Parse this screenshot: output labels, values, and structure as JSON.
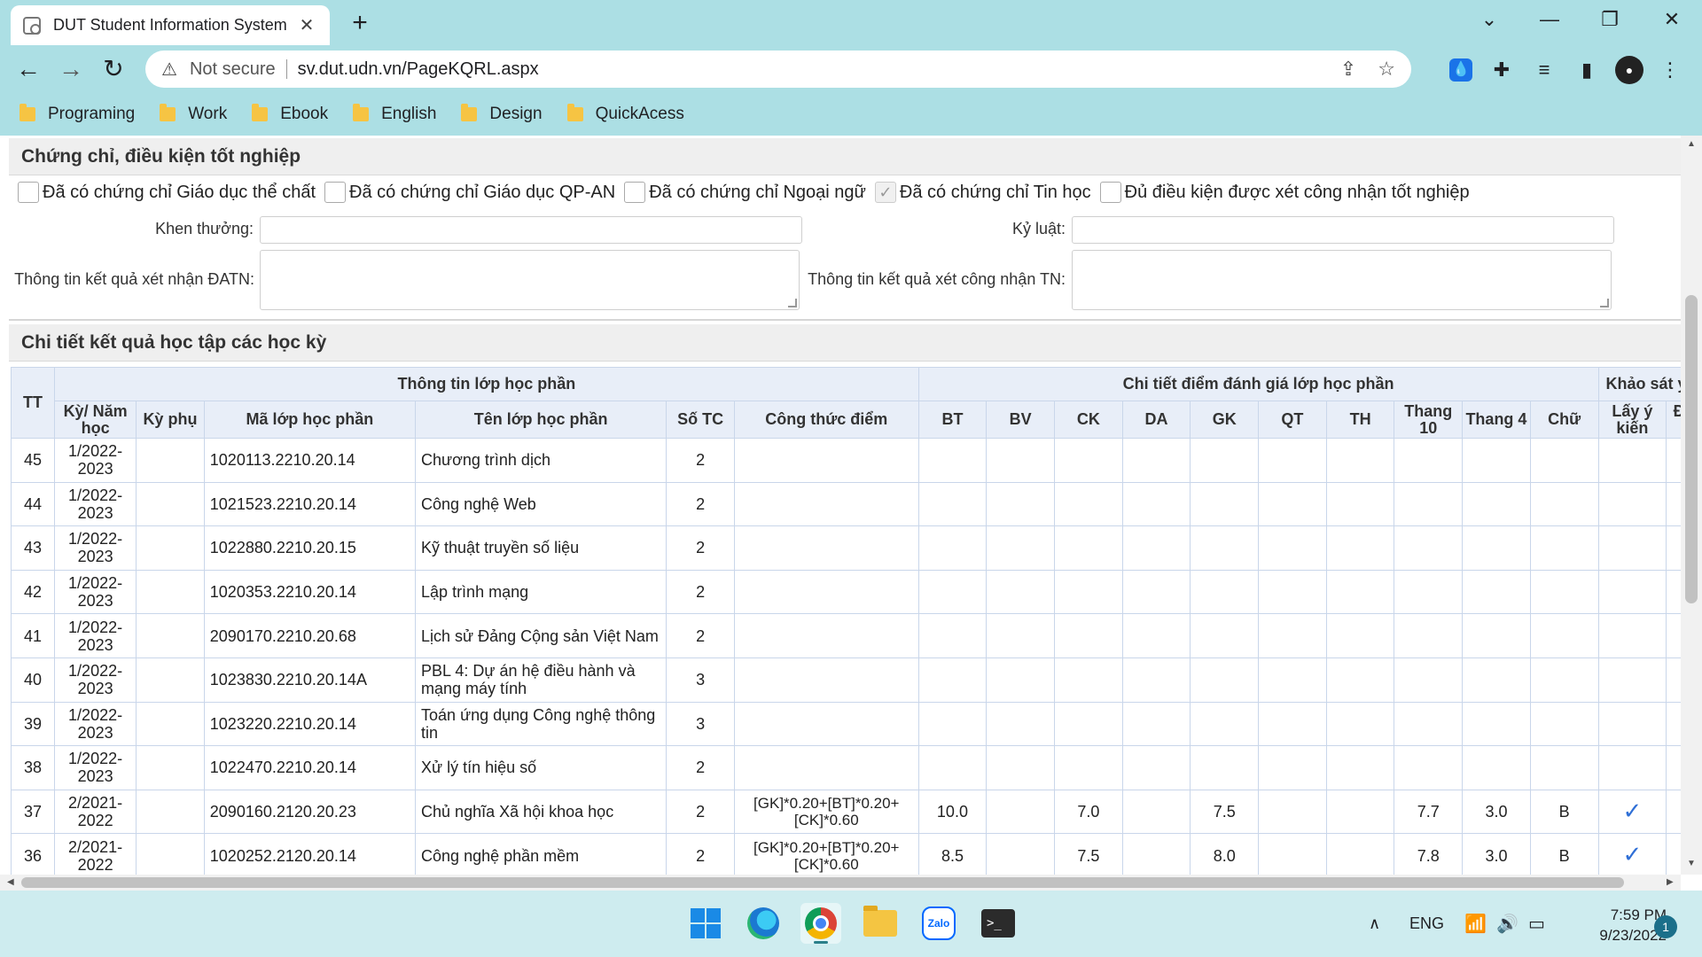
{
  "browser": {
    "tab_title": "DUT Student Information System",
    "tab_close": "✕",
    "new_tab": "+",
    "security_label": "Not secure",
    "url": "sv.dut.udn.vn/PageKQRL.aspx",
    "bookmarks": [
      "Programing",
      "Work",
      "Ebook",
      "English",
      "Design",
      "QuickAcess"
    ]
  },
  "certificates": {
    "title": "Chứng chỉ, điều kiện tốt nghiệp",
    "items": [
      {
        "label": "Đã có chứng chỉ Giáo dục thể chất",
        "checked": false
      },
      {
        "label": "Đã có chứng chỉ Giáo dục QP-AN",
        "checked": false
      },
      {
        "label": "Đã có chứng chỉ Ngoại ngữ",
        "checked": false
      },
      {
        "label": "Đã có chứng chỉ Tin học",
        "checked": true
      },
      {
        "label": "Đủ điều kiện được xét công nhận tốt nghiệp",
        "checked": false
      }
    ],
    "khen_thuong_label": "Khen thưởng:",
    "ky_luat_label": "Kỷ luật:",
    "datn_label": "Thông tin kết quả xét nhận ĐATN:",
    "tn_label": "Thông tin kết quả xét công nhận TN:"
  },
  "results": {
    "title": "Chi tiết kết quả học tập các học kỳ",
    "group_headers": {
      "tt": "TT",
      "class_info": "Thông tin lớp học phần",
      "score_detail": "Chi tiết điểm đánh giá lớp học phần",
      "survey": "Khảo sát ý kiến"
    },
    "columns": {
      "ky": "Kỳ/ Năm học",
      "ky_phu": "Kỳ phụ",
      "ma_lop": "Mã lớp học phần",
      "ten_lop": "Tên lớp học phần",
      "so_tc": "Số TC",
      "cong_thuc": "Công thức điểm",
      "bt": "BT",
      "bv": "BV",
      "ck": "CK",
      "da": "DA",
      "gk": "GK",
      "qt": "QT",
      "th": "TH",
      "thang10": "Thang 10",
      "thang4": "Thang 4",
      "chu": "Chữ",
      "lay_y_kien": "Lấy ý kiến",
      "da_gop_y": "Đã góp ý"
    },
    "rows": [
      {
        "tt": "45",
        "ky": "1/2022-2023",
        "ky_phu": "",
        "ma": "1020113.2210.20.14",
        "ten": "Chương trình dịch",
        "tc": "2",
        "ct": "",
        "bt": "",
        "bv": "",
        "ck": "",
        "da": "",
        "gk": "",
        "qt": "",
        "th": "",
        "t10": "",
        "t4": "",
        "chu": "",
        "lay": "",
        "gop": ""
      },
      {
        "tt": "44",
        "ky": "1/2022-2023",
        "ky_phu": "",
        "ma": "1021523.2210.20.14",
        "ten": "Công nghệ Web",
        "tc": "2",
        "ct": "",
        "bt": "",
        "bv": "",
        "ck": "",
        "da": "",
        "gk": "",
        "qt": "",
        "th": "",
        "t10": "",
        "t4": "",
        "chu": "",
        "lay": "",
        "gop": ""
      },
      {
        "tt": "43",
        "ky": "1/2022-2023",
        "ky_phu": "",
        "ma": "1022880.2210.20.15",
        "ten": "Kỹ thuật truyền số liệu",
        "tc": "2",
        "ct": "",
        "bt": "",
        "bv": "",
        "ck": "",
        "da": "",
        "gk": "",
        "qt": "",
        "th": "",
        "t10": "",
        "t4": "",
        "chu": "",
        "lay": "",
        "gop": ""
      },
      {
        "tt": "42",
        "ky": "1/2022-2023",
        "ky_phu": "",
        "ma": "1020353.2210.20.14",
        "ten": "Lập trình mạng",
        "tc": "2",
        "ct": "",
        "bt": "",
        "bv": "",
        "ck": "",
        "da": "",
        "gk": "",
        "qt": "",
        "th": "",
        "t10": "",
        "t4": "",
        "chu": "",
        "lay": "",
        "gop": ""
      },
      {
        "tt": "41",
        "ky": "1/2022-2023",
        "ky_phu": "",
        "ma": "2090170.2210.20.68",
        "ten": "Lịch sử Đảng Cộng sản Việt Nam",
        "tc": "2",
        "ct": "",
        "bt": "",
        "bv": "",
        "ck": "",
        "da": "",
        "gk": "",
        "qt": "",
        "th": "",
        "t10": "",
        "t4": "",
        "chu": "",
        "lay": "",
        "gop": ""
      },
      {
        "tt": "40",
        "ky": "1/2022-2023",
        "ky_phu": "",
        "ma": "1023830.2210.20.14A",
        "ten": "PBL 4: Dự án hệ điều hành và mạng máy tính",
        "tc": "3",
        "ct": "",
        "bt": "",
        "bv": "",
        "ck": "",
        "da": "",
        "gk": "",
        "qt": "",
        "th": "",
        "t10": "",
        "t4": "",
        "chu": "",
        "lay": "",
        "gop": ""
      },
      {
        "tt": "39",
        "ky": "1/2022-2023",
        "ky_phu": "",
        "ma": "1023220.2210.20.14",
        "ten": "Toán ứng dụng Công nghệ thông tin",
        "tc": "3",
        "ct": "",
        "bt": "",
        "bv": "",
        "ck": "",
        "da": "",
        "gk": "",
        "qt": "",
        "th": "",
        "t10": "",
        "t4": "",
        "chu": "",
        "lay": "",
        "gop": ""
      },
      {
        "tt": "38",
        "ky": "1/2022-2023",
        "ky_phu": "",
        "ma": "1022470.2210.20.14",
        "ten": "Xử lý tín hiệu số",
        "tc": "2",
        "ct": "",
        "bt": "",
        "bv": "",
        "ck": "",
        "da": "",
        "gk": "",
        "qt": "",
        "th": "",
        "t10": "",
        "t4": "",
        "chu": "",
        "lay": "",
        "gop": ""
      },
      {
        "tt": "37",
        "ky": "2/2021-2022",
        "ky_phu": "",
        "ma": "2090160.2120.20.23",
        "ten": "Chủ nghĩa Xã hội khoa học",
        "tc": "2",
        "ct": "[GK]*0.20+[BT]*0.20+[CK]*0.60",
        "bt": "10.0",
        "bv": "",
        "ck": "7.0",
        "da": "",
        "gk": "7.5",
        "qt": "",
        "th": "",
        "t10": "7.7",
        "t4": "3.0",
        "chu": "B",
        "lay": "✓",
        "gop": ""
      },
      {
        "tt": "36",
        "ky": "2/2021-2022",
        "ky_phu": "",
        "ma": "1020252.2120.20.14",
        "ten": "Công nghệ phần mềm",
        "tc": "2",
        "ct": "[GK]*0.20+[BT]*0.20+[CK]*0.60",
        "bt": "8.5",
        "bv": "",
        "ck": "7.5",
        "da": "",
        "gk": "8.0",
        "qt": "",
        "th": "",
        "t10": "7.8",
        "t4": "3.0",
        "chu": "B",
        "lay": "✓",
        "gop": ""
      }
    ]
  },
  "taskbar": {
    "language": "ENG",
    "time": "7:59 PM",
    "date": "9/23/2022",
    "notifications": "1",
    "zalo_label": "Zalo",
    "terminal_label": ">_"
  },
  "colors": {
    "chrome_bg": "#acdfe4",
    "header_bg": "#e8eef8",
    "check": "#2f6fd6"
  }
}
